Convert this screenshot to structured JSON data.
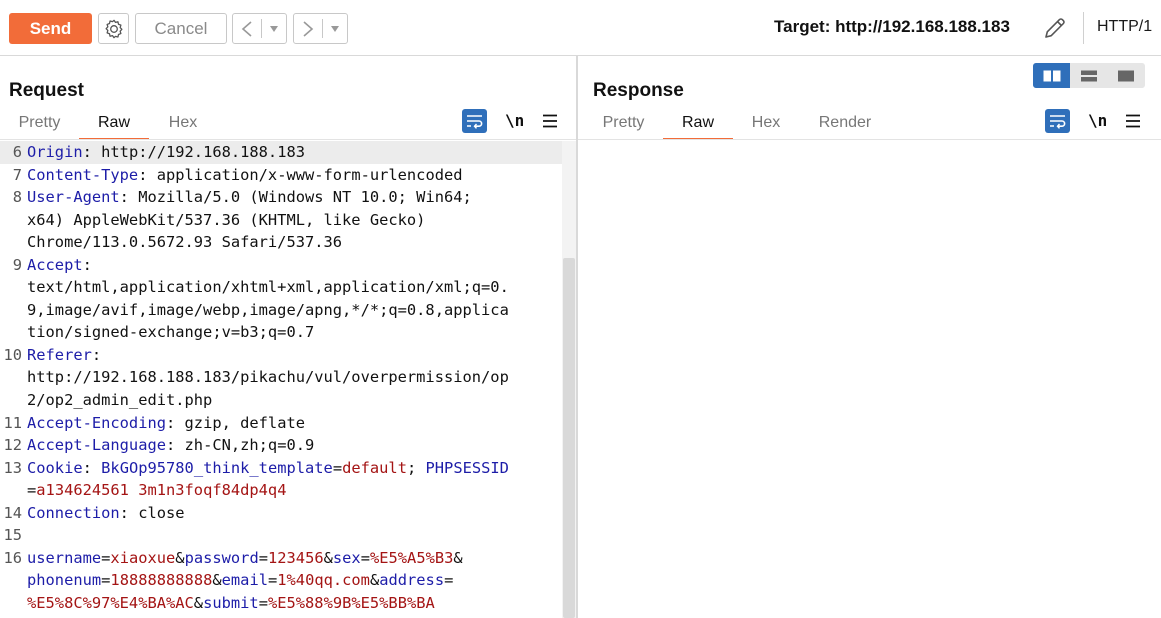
{
  "toolbar": {
    "send_label": "Send",
    "cancel_label": "Cancel",
    "back_label": "<",
    "forward_label": ">",
    "dropdown_glyph": "▾",
    "target_text": "Target: http://192.168.188.183",
    "http_version": "HTTP/1",
    "icons": [
      "gear-icon",
      "edit-icon"
    ],
    "accent_color": "#f26c39"
  },
  "request": {
    "title": "Request",
    "tabs": [
      "Pretty",
      "Raw",
      "Hex"
    ],
    "active_tab": "Raw",
    "newline_label": "\\n",
    "lines": [
      {
        "n": "6",
        "parts": [
          [
            "k",
            "Origin"
          ],
          [
            "p",
            ": http://192.168.188.183"
          ]
        ]
      },
      {
        "n": "7",
        "parts": [
          [
            "k",
            "Content-Type"
          ],
          [
            "p",
            ": application/x-www-form-urlencoded"
          ]
        ]
      },
      {
        "n": "8",
        "parts": [
          [
            "k",
            "User-Agent"
          ],
          [
            "p",
            ": Mozilla/5.0 (Windows NT 10.0; Win64;\nx64) AppleWebKit/537.36 (KHTML, like Gecko)\nChrome/113.0.5672.93 Safari/537.36"
          ]
        ]
      },
      {
        "n": "9",
        "parts": [
          [
            "k",
            "Accept"
          ],
          [
            "p",
            ":\ntext/html,application/xhtml+xml,application/xml;q=0.\n9,image/avif,image/webp,image/apng,*/*;q=0.8,applica\ntion/signed-exchange;v=b3;q=0.7"
          ]
        ]
      },
      {
        "n": "10",
        "parts": [
          [
            "k",
            "Referer"
          ],
          [
            "p",
            ":\nhttp://192.168.188.183/pikachu/vul/overpermission/op\n2/op2_admin_edit.php"
          ]
        ]
      },
      {
        "n": "11",
        "parts": [
          [
            "k",
            "Accept-Encoding"
          ],
          [
            "p",
            ": gzip, deflate"
          ]
        ]
      },
      {
        "n": "12",
        "parts": [
          [
            "k",
            "Accept-Language"
          ],
          [
            "p",
            ": zh-CN,zh;q=0.9"
          ]
        ]
      },
      {
        "n": "13",
        "parts": [
          [
            "k",
            "Cookie"
          ],
          [
            "p",
            ": "
          ],
          [
            "k",
            "BkGOp95780_think_template"
          ],
          [
            "p",
            "="
          ],
          [
            "r",
            "default"
          ],
          [
            "p",
            "; "
          ],
          [
            "k",
            "PHPSESSID"
          ],
          [
            "p",
            "\n="
          ],
          [
            "r",
            "a134624561 3m1n3foqf84dp4q4"
          ]
        ]
      },
      {
        "n": "14",
        "parts": [
          [
            "k",
            "Connection"
          ],
          [
            "p",
            ": close"
          ]
        ]
      },
      {
        "n": "15",
        "parts": [
          [
            "p",
            ""
          ]
        ]
      },
      {
        "n": "16",
        "parts": [
          [
            "k",
            "username"
          ],
          [
            "p",
            "="
          ],
          [
            "r",
            "xiaoxue"
          ],
          [
            "p",
            "&"
          ],
          [
            "k",
            "password"
          ],
          [
            "p",
            "="
          ],
          [
            "r",
            "123456"
          ],
          [
            "p",
            "&"
          ],
          [
            "k",
            "sex"
          ],
          [
            "p",
            "="
          ],
          [
            "r",
            "%E5%A5%B3"
          ],
          [
            "p",
            "&\n"
          ],
          [
            "k",
            "phonenum"
          ],
          [
            "p",
            "="
          ],
          [
            "r",
            "18888888888"
          ],
          [
            "p",
            "&"
          ],
          [
            "k",
            "email"
          ],
          [
            "p",
            "="
          ],
          [
            "r",
            "1%40qq.com"
          ],
          [
            "p",
            "&"
          ],
          [
            "k",
            "address"
          ],
          [
            "p",
            "=\n"
          ],
          [
            "r",
            "%E5%8C%97%E4%BA%AC"
          ],
          [
            "p",
            "&"
          ],
          [
            "k",
            "submit"
          ],
          [
            "p",
            "="
          ],
          [
            "r",
            "%E5%88%9B%E5%BB%BA"
          ]
        ]
      }
    ]
  },
  "response": {
    "title": "Response",
    "tabs": [
      "Pretty",
      "Raw",
      "Hex",
      "Render"
    ],
    "active_tab": "Raw",
    "newline_label": "\\n"
  },
  "colors": {
    "header_key": "#1d1da8",
    "value_red": "#a41414",
    "toggle_blue": "#2f6fba"
  }
}
